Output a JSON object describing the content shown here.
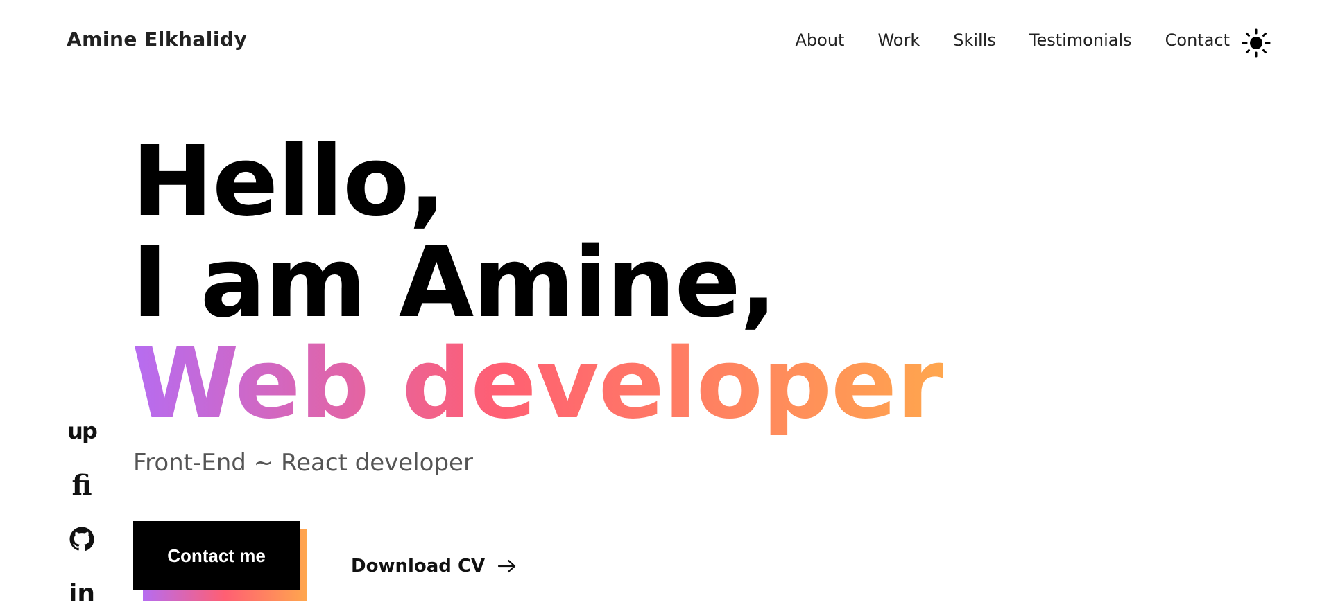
{
  "header": {
    "brand": "Amine Elkhalidy",
    "nav": [
      "About",
      "Work",
      "Skills",
      "Testimonials",
      "Contact"
    ],
    "theme_icon": "sun-icon"
  },
  "hero": {
    "line1": "Hello,",
    "line2": "I am Amine,",
    "line3": "Web developer",
    "subtitle": "Front-End ~ React developer"
  },
  "actions": {
    "contact_label": "Contact me",
    "download_label": "Download CV",
    "download_icon": "arrow-right-icon"
  },
  "social": {
    "upwork_text": "up",
    "fiverr_text": "fi",
    "github_icon": "github-icon",
    "linkedin_text": "in"
  },
  "colors": {
    "gradient_start": "#b66cf1",
    "gradient_mid": "#ff5f73",
    "gradient_end": "#ffa64e",
    "button_bg": "#000000"
  }
}
